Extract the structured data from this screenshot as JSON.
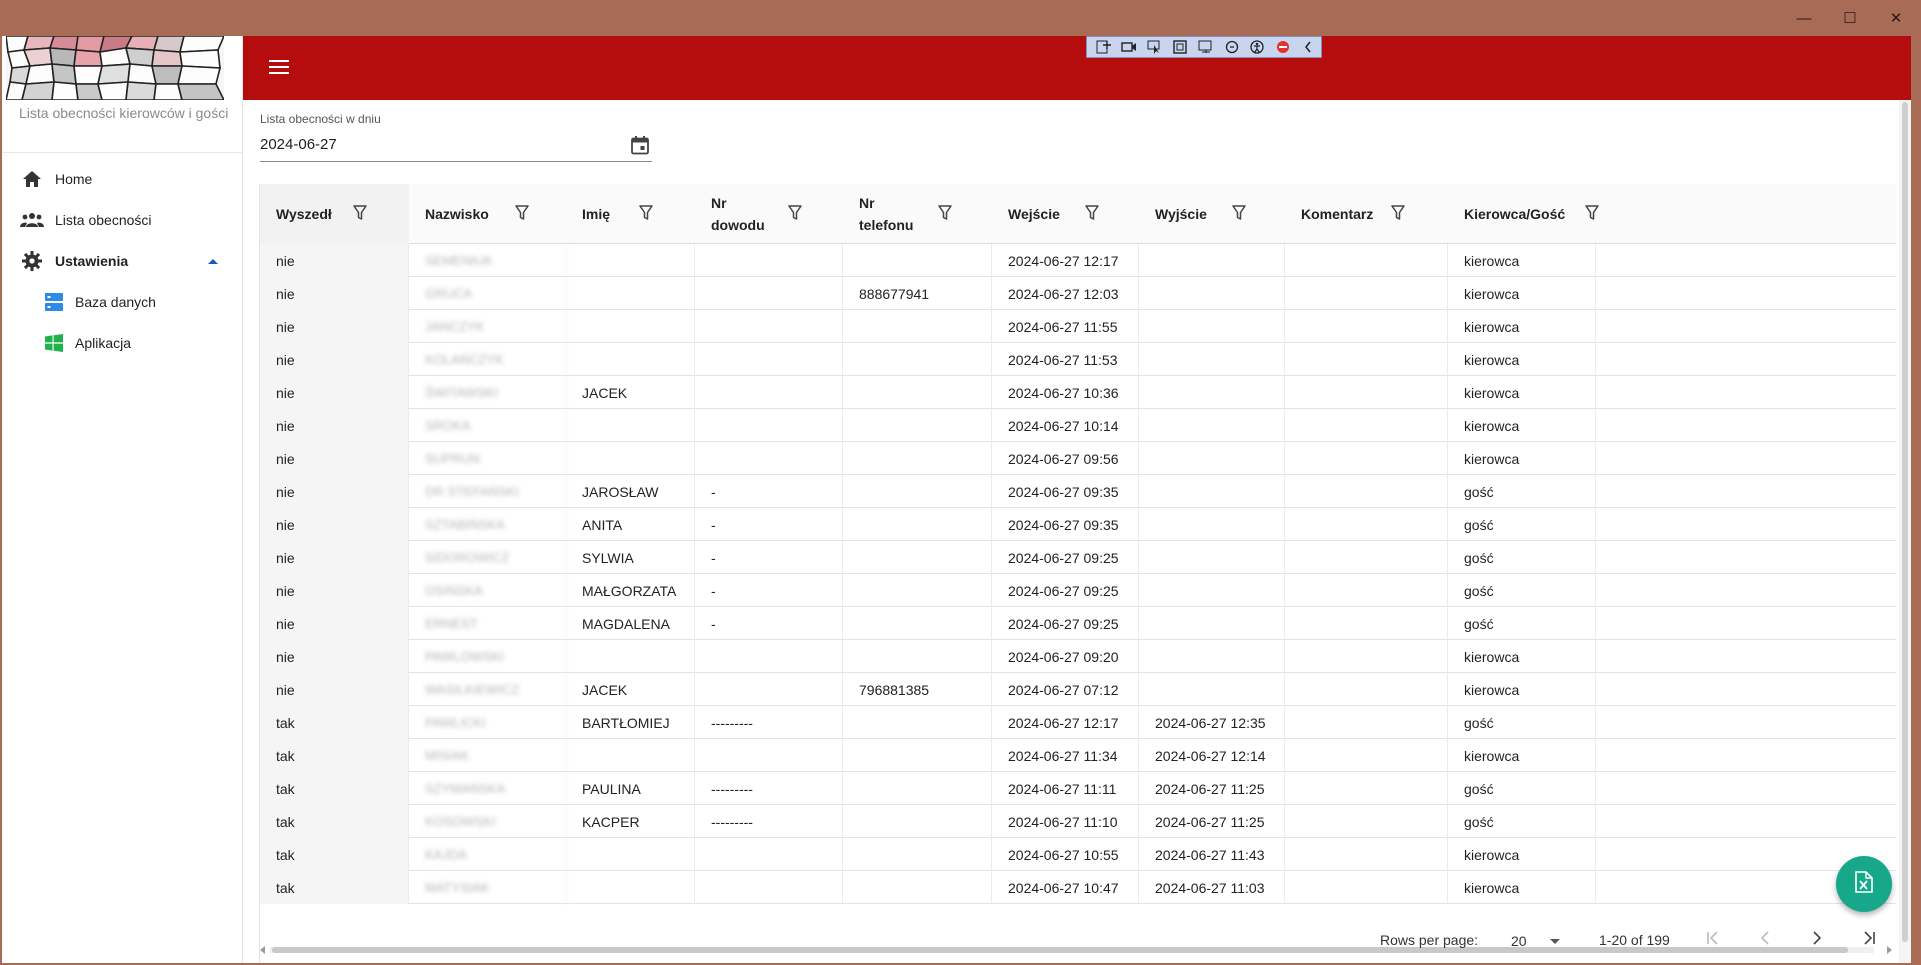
{
  "window": {
    "minimize": "—",
    "maximize": "☐",
    "close": "✕"
  },
  "sidebar": {
    "subtitle": "Lista obecności kierowców i gości",
    "items": [
      {
        "label": "Home",
        "icon": "home-icon"
      },
      {
        "label": "Lista obecności",
        "icon": "people-icon"
      },
      {
        "label": "Ustawienia",
        "icon": "gear-icon"
      },
      {
        "label": "Baza danych",
        "icon": "database-icon"
      },
      {
        "label": "Aplikacja",
        "icon": "windows-icon"
      }
    ]
  },
  "header": {
    "color": "#b50d0d"
  },
  "date_filter": {
    "label": "Lista obecności w dniu",
    "value": "2024-06-27"
  },
  "grid": {
    "columns": [
      "Wyszedł",
      "Nazwisko",
      "Imię",
      "Nr dowodu",
      "Nr telefonu",
      "Wejście",
      "Wyjście",
      "Komentarz",
      "Kierowca/Gość"
    ],
    "rows": [
      [
        "nie",
        "SEMENIUK",
        "",
        "",
        "",
        "2024-06-27 12:17",
        "",
        "",
        "kierowca"
      ],
      [
        "nie",
        "GRUCA",
        "",
        "",
        "888677941",
        "2024-06-27 12:03",
        "",
        "",
        "kierowca"
      ],
      [
        "nie",
        "JANCZYK",
        "",
        "",
        "",
        "2024-06-27 11:55",
        "",
        "",
        "kierowca"
      ],
      [
        "nie",
        "KOLAŃCZYK",
        "",
        "",
        "",
        "2024-06-27 11:53",
        "",
        "",
        "kierowca"
      ],
      [
        "nie",
        "ŚWITAWSKI",
        "JACEK",
        "",
        "",
        "2024-06-27 10:36",
        "",
        "",
        "kierowca"
      ],
      [
        "nie",
        "SROKA",
        "",
        "",
        "",
        "2024-06-27 10:14",
        "",
        "",
        "kierowca"
      ],
      [
        "nie",
        "SUPRUN",
        "",
        "",
        "",
        "2024-06-27 09:56",
        "",
        "",
        "kierowca"
      ],
      [
        "nie",
        "DR STEFAŃSKI",
        "JAROSŁAW",
        "-",
        "",
        "2024-06-27 09:35",
        "",
        "",
        "gość"
      ],
      [
        "nie",
        "SZTABIŃSKA",
        "ANITA",
        "-",
        "",
        "2024-06-27 09:35",
        "",
        "",
        "gość"
      ],
      [
        "nie",
        "SIDOROWICZ",
        "SYLWIA",
        "-",
        "",
        "2024-06-27 09:25",
        "",
        "",
        "gość"
      ],
      [
        "nie",
        "OSIŃSKA",
        "MAŁGORZATA",
        "-",
        "",
        "2024-06-27 09:25",
        "",
        "",
        "gość"
      ],
      [
        "nie",
        "ERNEST",
        "MAGDALENA",
        "-",
        "",
        "2024-06-27 09:25",
        "",
        "",
        "gość"
      ],
      [
        "nie",
        "PAWLOWSKI",
        "",
        "",
        "",
        "2024-06-27 09:20",
        "",
        "",
        "kierowca"
      ],
      [
        "nie",
        "WASILKIEWICZ",
        "JACEK",
        "",
        "796881385",
        "2024-06-27 07:12",
        "",
        "",
        "kierowca"
      ],
      [
        "tak",
        "PAWLICKI",
        "BARTŁOMIEJ",
        "---------",
        "",
        "2024-06-27 12:17",
        "2024-06-27 12:35",
        "",
        "gość"
      ],
      [
        "tak",
        "MISIAK",
        "",
        "",
        "",
        "2024-06-27 11:34",
        "2024-06-27 12:14",
        "",
        "kierowca"
      ],
      [
        "tak",
        "SZYMAŃSKA",
        "PAULINA",
        "---------",
        "",
        "2024-06-27 11:11",
        "2024-06-27 11:25",
        "",
        "gość"
      ],
      [
        "tak",
        "KOSOWSKI",
        "KACPER",
        "---------",
        "",
        "2024-06-27 11:10",
        "2024-06-27 11:25",
        "",
        "gość"
      ],
      [
        "tak",
        "KAJDA",
        "",
        "",
        "",
        "2024-06-27 10:55",
        "2024-06-27 11:43",
        "",
        "kierowca"
      ],
      [
        "tak",
        "MATYSIAK",
        "",
        "",
        "",
        "2024-06-27 10:47",
        "2024-06-27 11:03",
        "",
        "kierowca"
      ]
    ]
  },
  "pagination": {
    "rows_per_page_label": "Rows per page:",
    "rows_per_page": "20",
    "range": "1-20 of 199"
  },
  "fab": {
    "icon": "excel-export-icon",
    "color": "#17a88c"
  }
}
